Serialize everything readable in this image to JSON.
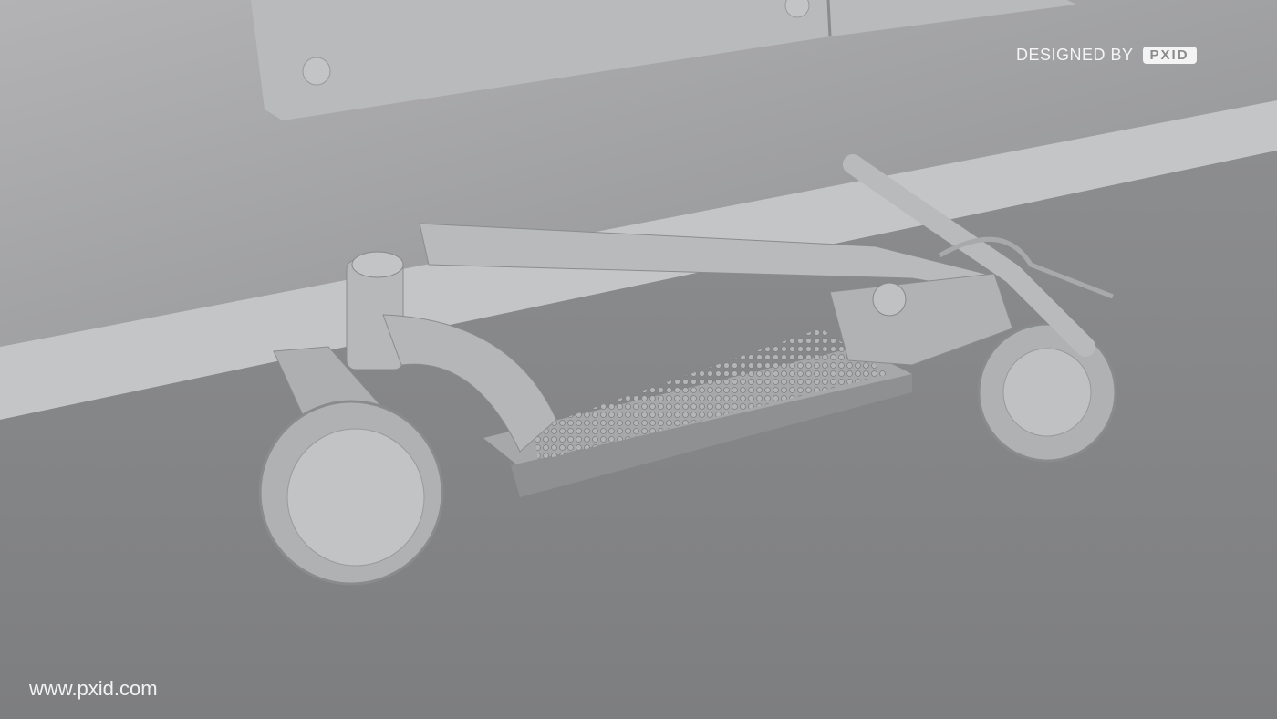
{
  "watermark": {
    "designed_by": "DESIGNED BY",
    "brand_logo": "PXID"
  },
  "website": "www.pxid.com"
}
